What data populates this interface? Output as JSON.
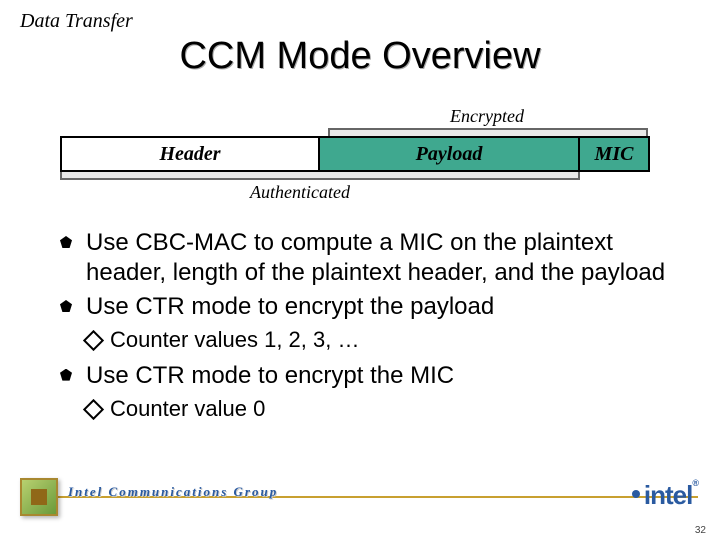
{
  "section": "Data Transfer",
  "title": "CCM Mode Overview",
  "diagram": {
    "encrypted_label": "Encrypted",
    "authenticated_label": "Authenticated",
    "header": "Header",
    "payload": "Payload",
    "mic": "MIC"
  },
  "bullets": {
    "b1": "Use CBC-MAC to compute a MIC on the plaintext header, length of the plaintext header, and the payload",
    "b2": "Use CTR mode to encrypt the payload",
    "b2_sub": "Counter values 1, 2, 3, …",
    "b3": "Use CTR mode to encrypt the MIC",
    "b3_sub": "Counter value 0"
  },
  "footer": {
    "group": "Intel Communications Group",
    "logo": "intel",
    "slide_number": "32"
  }
}
